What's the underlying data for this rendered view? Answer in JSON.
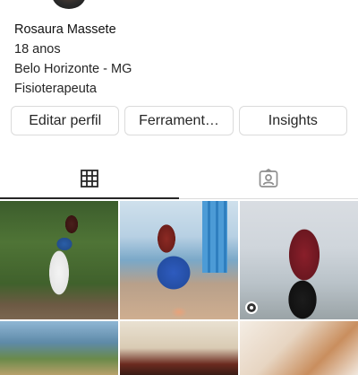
{
  "profile": {
    "name": "Rosaura Massete",
    "age": "18 anos",
    "location": "Belo Horizonte - MG",
    "occupation": "Fisioterapeuta"
  },
  "actions": {
    "edit_label": "Editar perfil",
    "tools_label": "Ferrament…",
    "insights_label": "Insights"
  },
  "tabs": [
    {
      "name": "grid",
      "icon": "grid-icon",
      "active": true
    },
    {
      "name": "tagged",
      "icon": "tagged-person-icon",
      "active": false
    }
  ],
  "colors": {
    "text": "#262626",
    "border": "#dbdbdb",
    "active_indicator": "#262626"
  }
}
